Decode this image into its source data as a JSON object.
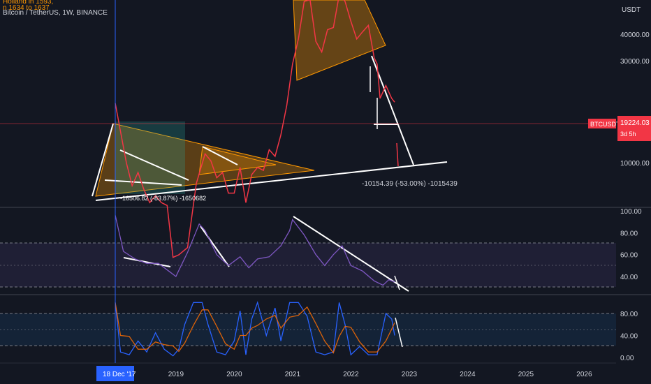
{
  "header": {
    "note_line1": "Holland in 1593,",
    "note_line2": "n 1634 to 1637",
    "symbol": "Bitcoin / TetherUS, 1W, BINANCE"
  },
  "colors": {
    "background": "#131722",
    "price_line": "#f23645",
    "rsi_line": "#7e57c2",
    "rsi_ma": "#f0d35a",
    "stoch_k": "#2962ff",
    "stoch_d": "#ff6d00",
    "triangle_fill": "#ff9800",
    "annotation": "#ffffff",
    "crosshair": "#2962ff"
  },
  "price_scale": {
    "unit": "USDT",
    "ticks": [
      "40000.00",
      "30000.00",
      "10000.00"
    ],
    "tick_values": [
      40000,
      30000,
      10000
    ],
    "current_symbol": "BTCUSDT",
    "current_value": "19224.03",
    "countdown": "3d 5h"
  },
  "annotations": {
    "measure_2018": "-16506.82 (-83.87%) -1650682",
    "measure_2022": "-10154.39 (-53.00%) -1015439"
  },
  "rsi_scale": {
    "ticks": [
      "100.00",
      "80.00",
      "60.00",
      "40.00"
    ],
    "tick_values": [
      100,
      80,
      60,
      40
    ]
  },
  "stoch_scale": {
    "ticks": [
      "80.00",
      "40.00",
      "0.00"
    ],
    "tick_values": [
      80,
      40,
      0
    ]
  },
  "time_axis": {
    "labels": [
      "2019",
      "2020",
      "2021",
      "2022",
      "2023",
      "2024",
      "2025",
      "2026"
    ],
    "label_years": [
      2019,
      2020,
      2021,
      2022,
      2023,
      2024,
      2025,
      2026
    ],
    "crosshair_label": "18 Dec '17",
    "crosshair_date": 2017.96
  },
  "chart_data": {
    "type": "line",
    "series": [
      {
        "kind": "price",
        "x": [
          2017.96,
          2018.05,
          2018.15,
          2018.25,
          2018.35,
          2018.45,
          2018.55,
          2018.65,
          2018.75,
          2018.85,
          2018.95,
          2019.05,
          2019.2,
          2019.35,
          2019.5,
          2019.6,
          2019.7,
          2019.8,
          2019.9,
          2020.0,
          2020.1,
          2020.2,
          2020.3,
          2020.4,
          2020.5,
          2020.6,
          2020.7,
          2020.8,
          2020.9,
          2021.0,
          2021.1,
          2021.2,
          2021.3,
          2021.4,
          2021.5,
          2021.6,
          2021.7,
          2021.8,
          2021.9,
          2022.0,
          2022.1,
          2022.2,
          2022.3,
          2022.4,
          2022.45,
          2022.5,
          2022.6,
          2022.7,
          2022.75
        ],
        "y": [
          19000,
          14000,
          10000,
          7800,
          9000,
          7500,
          6500,
          7000,
          6500,
          6300,
          3600,
          3700,
          4000,
          8000,
          11000,
          10200,
          8500,
          9000,
          7200,
          7200,
          9500,
          6500,
          8800,
          9500,
          9200,
          11500,
          10700,
          13500,
          18500,
          29000,
          38000,
          57000,
          58000,
          37000,
          33000,
          42000,
          43000,
          61000,
          57000,
          46000,
          38000,
          41000,
          44000,
          31000,
          29000,
          20000,
          23000,
          20000,
          19224
        ]
      },
      {
        "kind": "rsi",
        "x": [
          2017.96,
          2018.1,
          2018.3,
          2018.5,
          2018.7,
          2018.9,
          2019.0,
          2019.2,
          2019.4,
          2019.5,
          2019.7,
          2019.9,
          2020.1,
          2020.25,
          2020.4,
          2020.6,
          2020.8,
          2020.95,
          2021.0,
          2021.2,
          2021.4,
          2021.55,
          2021.7,
          2021.85,
          2022.0,
          2022.2,
          2022.4,
          2022.55,
          2022.65,
          2022.75
        ],
        "y": [
          96,
          63,
          56,
          52,
          52,
          44,
          40,
          62,
          88,
          82,
          60,
          50,
          58,
          48,
          56,
          58,
          68,
          82,
          92,
          78,
          60,
          50,
          60,
          68,
          50,
          45,
          36,
          32,
          37,
          35
        ]
      },
      {
        "kind": "stoch_k",
        "x": [
          2017.96,
          2018.05,
          2018.2,
          2018.35,
          2018.5,
          2018.65,
          2018.8,
          2018.95,
          2019.05,
          2019.15,
          2019.3,
          2019.45,
          2019.55,
          2019.7,
          2019.85,
          2020.0,
          2020.1,
          2020.2,
          2020.3,
          2020.4,
          2020.55,
          2020.7,
          2020.8,
          2020.95,
          2021.1,
          2021.25,
          2021.4,
          2021.55,
          2021.7,
          2021.8,
          2021.9,
          2022.0,
          2022.15,
          2022.3,
          2022.45,
          2022.6,
          2022.7,
          2022.75
        ],
        "y": [
          100,
          10,
          5,
          30,
          10,
          45,
          15,
          3,
          15,
          60,
          100,
          100,
          60,
          10,
          5,
          30,
          85,
          5,
          70,
          100,
          40,
          90,
          30,
          100,
          100,
          75,
          10,
          5,
          10,
          100,
          60,
          5,
          20,
          5,
          5,
          80,
          70,
          40
        ]
      }
    ],
    "title": "Bitcoin / TetherUS, 1W, BINANCE",
    "xlabel": "",
    "ylabel": "USDT",
    "xlim": [
      2017.96,
      2026.2
    ],
    "ylim": [
      5000,
      47000
    ],
    "rsi_ylim": [
      20,
      100
    ],
    "stoch_ylim": [
      0,
      100
    ],
    "grid": false,
    "legend": "top-left"
  }
}
